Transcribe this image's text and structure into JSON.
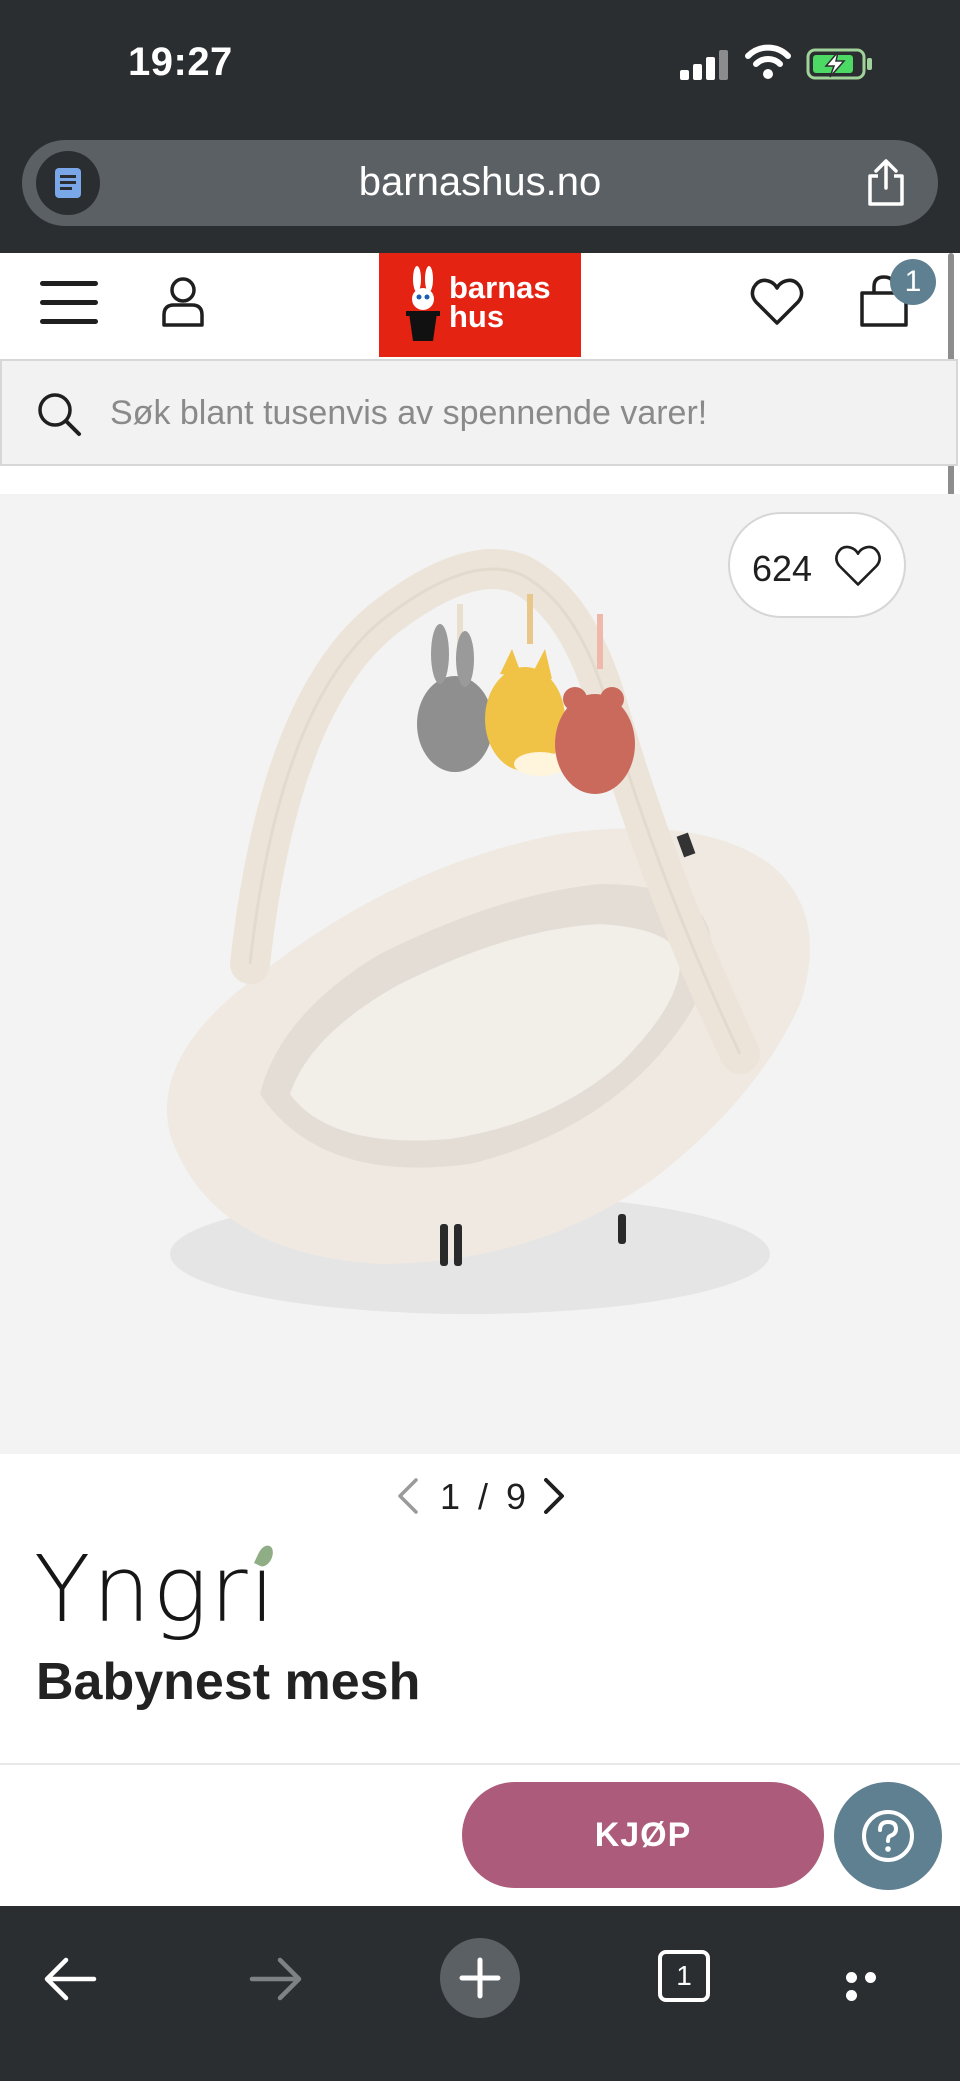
{
  "status_bar": {
    "time": "19:27"
  },
  "browser": {
    "url": "barnashus.no",
    "tab_count": "1"
  },
  "header": {
    "logo_line1": "barnas",
    "logo_line2": "hus",
    "cart_count": "1"
  },
  "search": {
    "placeholder": "Søk blant tusenvis av spennende varer!"
  },
  "product": {
    "favorite_count": "624",
    "image_index": "1 / 9",
    "brand": "Yngri",
    "title": "Babynest mesh"
  },
  "actions": {
    "buy_label": "KJØP"
  },
  "colors": {
    "brand_red": "#e42313",
    "buy_button": "#ad5b7b",
    "accent_blue": "#5f8091",
    "chrome_dark": "#2b2e30"
  },
  "icons": [
    "reader-icon",
    "share-icon",
    "menu-icon",
    "user-icon",
    "heart-icon",
    "bag-icon",
    "search-icon",
    "chevron-left-icon",
    "chevron-right-icon",
    "help-icon",
    "back-icon",
    "forward-icon",
    "plus-icon",
    "tabs-icon",
    "more-icon"
  ]
}
